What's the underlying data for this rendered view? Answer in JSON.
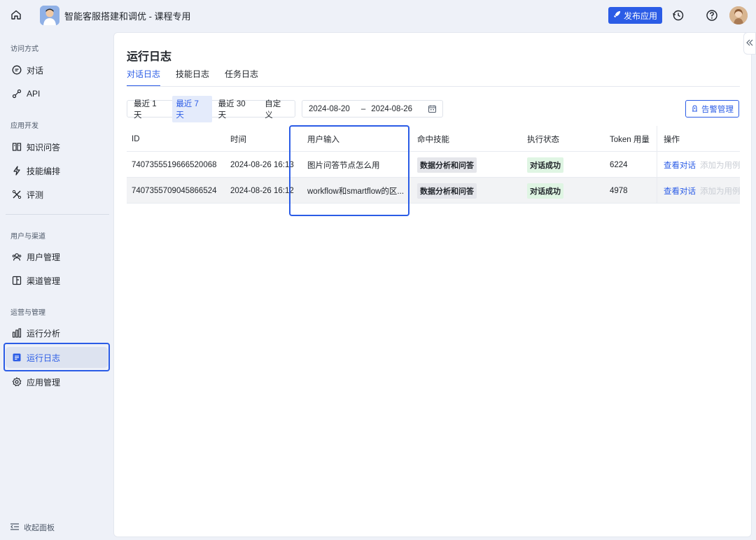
{
  "header": {
    "title": "智能客服搭建和调优 - 课程专用",
    "publish_label": "发布应用"
  },
  "sidebar": {
    "sections": [
      {
        "label": "访问方式",
        "items": [
          {
            "label": "对话",
            "icon": "chat-icon"
          },
          {
            "label": "API",
            "icon": "api-icon"
          }
        ]
      },
      {
        "label": "应用开发",
        "items": [
          {
            "label": "知识问答",
            "icon": "book-icon"
          },
          {
            "label": "技能编排",
            "icon": "bolt-icon"
          },
          {
            "label": "评测",
            "icon": "evaluate-icon"
          }
        ]
      },
      {
        "label": "用户与渠道",
        "items": [
          {
            "label": "用户管理",
            "icon": "users-icon"
          },
          {
            "label": "渠道管理",
            "icon": "channel-icon"
          }
        ]
      },
      {
        "label": "运营与管理",
        "items": [
          {
            "label": "运行分析",
            "icon": "bar-chart-icon"
          },
          {
            "label": "运行日志",
            "icon": "log-icon"
          },
          {
            "label": "应用管理",
            "icon": "gear-icon"
          }
        ]
      }
    ],
    "active": "运行日志",
    "collapse_label": "收起面板"
  },
  "main": {
    "title": "运行日志",
    "tabs": [
      "对话日志",
      "技能日志",
      "任务日志"
    ],
    "active_tab": "对话日志",
    "range_options": [
      "最近 1 天",
      "最近 7 天",
      "最近 30 天",
      "自定义"
    ],
    "active_range": "最近 7 天",
    "date_start": "2024-08-20",
    "date_sep": "–",
    "date_end": "2024-08-26",
    "alert_label": "告警管理",
    "table": {
      "columns": [
        "ID",
        "时间",
        "用户输入",
        "命中技能",
        "执行状态",
        "Token 用量",
        "操作"
      ],
      "rows": [
        {
          "id": "7407355519666520068",
          "time": "2024-08-26 16:13",
          "input": "图片问答节点怎么用",
          "skill": "数据分析和问答",
          "status": "对话成功",
          "token": "6224",
          "op_view": "查看对话",
          "op_add": "添加为用例"
        },
        {
          "id": "7407355709045866524",
          "time": "2024-08-26 16:12",
          "input": "workflow和smartflow的区...",
          "skill": "数据分析和问答",
          "status": "对话成功",
          "token": "4978",
          "op_view": "查看对话",
          "op_add": "添加为用例"
        }
      ]
    }
  },
  "colors": {
    "accent": "#2b5ce6",
    "success_bg": "#dff5e3",
    "tag_bg": "#e5e6eb"
  }
}
